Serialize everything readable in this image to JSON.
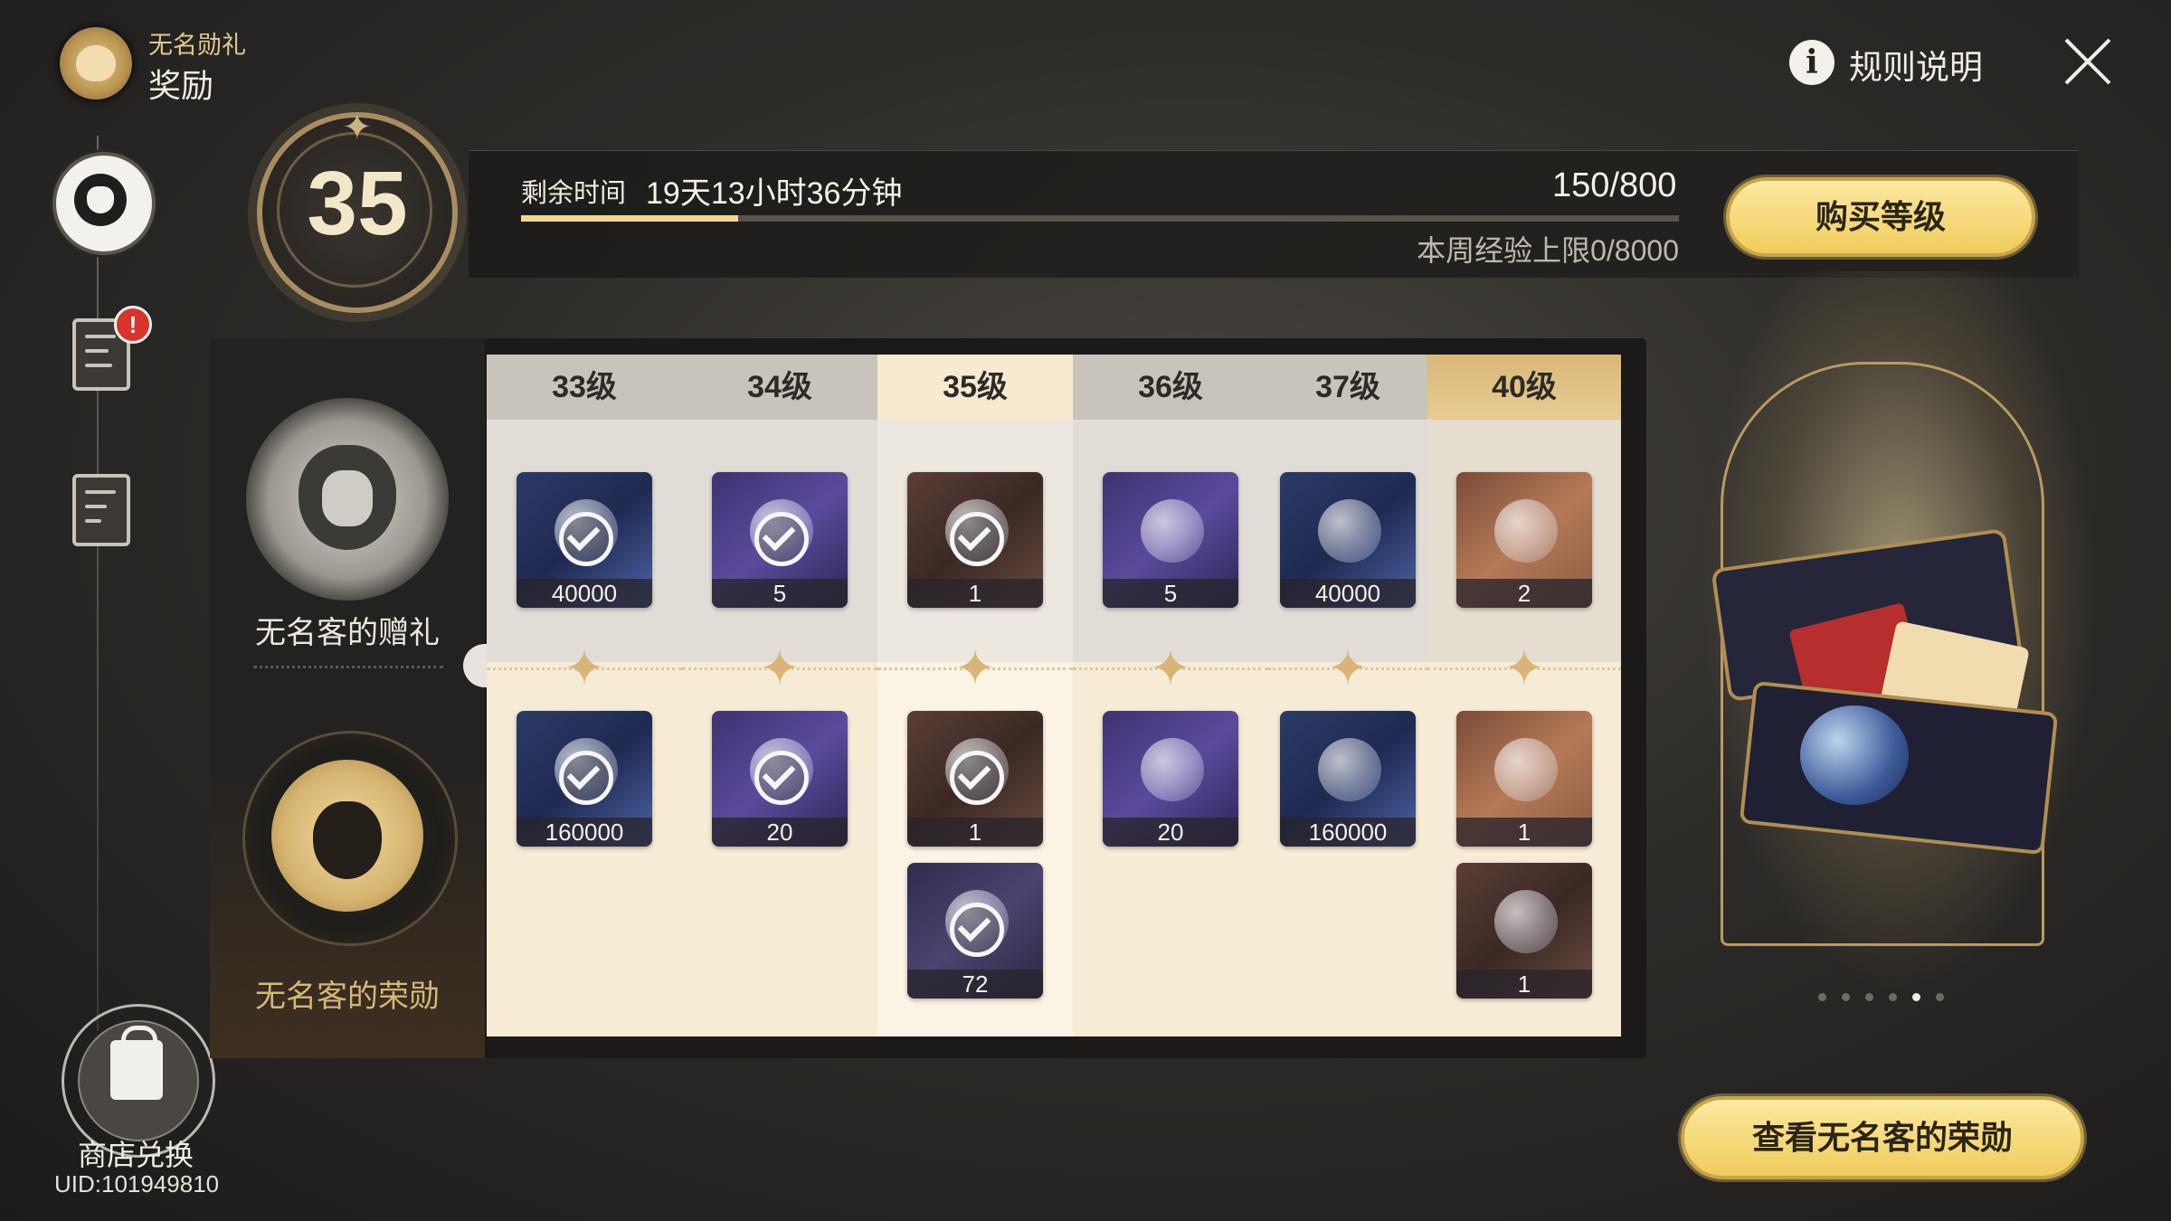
{
  "header": {
    "pass_name": "无名勋礼",
    "title": "奖励"
  },
  "level": {
    "current": "35"
  },
  "progress": {
    "time_label": "剩余时间",
    "time_value": "19天13小时36分钟",
    "exp_text": "150/800",
    "exp_fraction": 0.1875,
    "weekly_text": "本周经验上限0/8000"
  },
  "buttons": {
    "buy_level": "购买等级",
    "view_honor": "查看无名客的荣勋",
    "rules": "规则说明"
  },
  "tracks": {
    "free_label": "无名客的赠礼",
    "honor_label": "无名客的荣勋"
  },
  "sidebar": {
    "shop_label": "商店兑换",
    "uid": "UID:101949810",
    "badge": "!"
  },
  "levels": [
    {
      "label": "33级",
      "free": [
        {
          "qty": "40000",
          "claimed": true,
          "art": "blue"
        }
      ],
      "honor": [
        {
          "qty": "160000",
          "claimed": true,
          "art": "blue"
        }
      ]
    },
    {
      "label": "34级",
      "free": [
        {
          "qty": "5",
          "claimed": true,
          "art": "purple"
        }
      ],
      "honor": [
        {
          "qty": "20",
          "claimed": true,
          "art": "purple"
        }
      ]
    },
    {
      "label": "35级",
      "free": [
        {
          "qty": "1",
          "claimed": true,
          "art": "brown"
        }
      ],
      "honor": [
        {
          "qty": "1",
          "claimed": true,
          "art": "brown"
        },
        {
          "qty": "72",
          "claimed": true,
          "art": "dark"
        }
      ]
    },
    {
      "label": "36级",
      "free": [
        {
          "qty": "5",
          "claimed": false,
          "art": "purple"
        }
      ],
      "honor": [
        {
          "qty": "20",
          "claimed": false,
          "art": "purple"
        }
      ]
    },
    {
      "label": "37级",
      "free": [
        {
          "qty": "40000",
          "claimed": false,
          "art": "blue"
        }
      ],
      "honor": [
        {
          "qty": "160000",
          "claimed": false,
          "art": "blue"
        }
      ]
    },
    {
      "label": "40级",
      "free": [
        {
          "qty": "2",
          "claimed": false,
          "art": "gold"
        }
      ],
      "honor": [
        {
          "qty": "1",
          "claimed": false,
          "art": "gold"
        },
        {
          "qty": "1",
          "claimed": false,
          "art": "brown"
        }
      ]
    }
  ],
  "showcase": {
    "page_count": 6,
    "active_page": 5
  },
  "colors": {
    "accent_gold": "#f0cc5c",
    "panel_bg": "#1b1a19",
    "badge_red": "#d9342b"
  }
}
